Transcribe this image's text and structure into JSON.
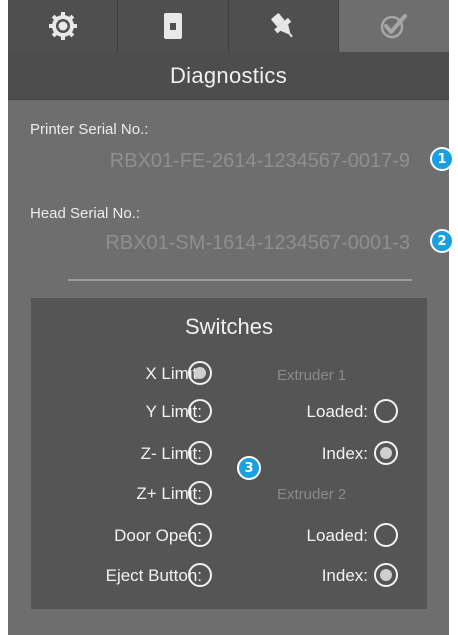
{
  "tabs": [
    {
      "icon": "gear-icon"
    },
    {
      "icon": "filament-spool-icon"
    },
    {
      "icon": "nozzle-icon"
    },
    {
      "icon": "checkmark-icon"
    }
  ],
  "header": {
    "title": "Diagnostics"
  },
  "printer_serial": {
    "label": "Printer Serial No.:",
    "value": "RBX01-FE-2614-1234567-0017-9"
  },
  "head_serial": {
    "label": "Head Serial No.:",
    "value": "RBX01-SM-1614-1234567-0001-3"
  },
  "badges": {
    "one": "1",
    "two": "2",
    "three": "3"
  },
  "colors": {
    "background": "#6e6e6e",
    "panel": "#555555",
    "badge": "#1aa0e0"
  },
  "switches": {
    "title": "Switches",
    "x_limit": {
      "label": "X Limit:",
      "on": true
    },
    "y_limit": {
      "label": "Y Limit:",
      "on": false
    },
    "z_minus_limit": {
      "label": "Z- Limit:",
      "on": false
    },
    "z_plus_limit": {
      "label": "Z+ Limit:",
      "on": false
    },
    "door_open": {
      "label": "Door Open:",
      "on": false
    },
    "eject_button": {
      "label": "Eject Button:",
      "on": false
    },
    "extruder1": {
      "heading": "Extruder 1",
      "loaded": {
        "label": "Loaded:",
        "on": false
      },
      "index": {
        "label": "Index:",
        "on": true
      }
    },
    "extruder2": {
      "heading": "Extruder 2",
      "loaded": {
        "label": "Loaded:",
        "on": false
      },
      "index": {
        "label": "Index:",
        "on": true
      }
    }
  }
}
